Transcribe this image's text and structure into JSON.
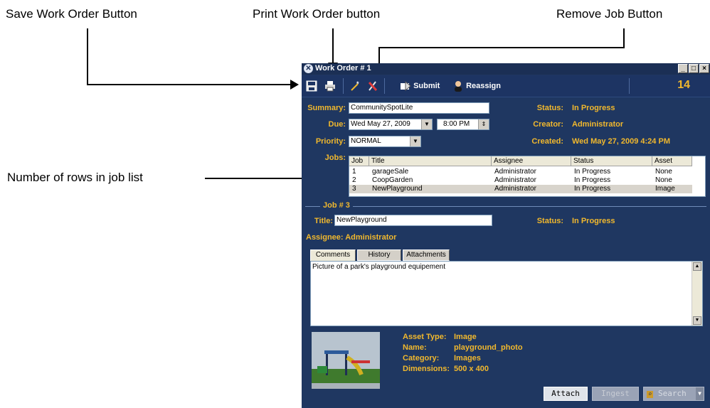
{
  "callouts": {
    "save": "Save Work Order Button",
    "print": "Print Work Order button",
    "remove": "Remove Job Button",
    "rows": "Number of rows in job list"
  },
  "window": {
    "title": "Work Order # 1",
    "buttons": {
      "min": "_",
      "max": "□",
      "close": "×"
    }
  },
  "toolbar": {
    "submit": "Submit",
    "reassign": "Reassign",
    "row_count": "14"
  },
  "order": {
    "summary_label": "Summary:",
    "summary": "CommunitySpotLite",
    "due_label": "Due:",
    "due_date": "Wed May 27, 2009",
    "due_time": "8:00 PM",
    "priority_label": "Priority:",
    "priority": "NORMAL",
    "status_label": "Status:",
    "status": "In Progress",
    "creator_label": "Creator:",
    "creator": "Administrator",
    "created_label": "Created:",
    "created": "Wed May 27, 2009 4:24 PM",
    "jobs_label": "Jobs:"
  },
  "jobs": {
    "columns": [
      "Job",
      "Title",
      "Assignee",
      "Status",
      "Asset"
    ],
    "rows": [
      {
        "job": "1",
        "title": "garageSale",
        "assignee": "Administrator",
        "status": "In Progress",
        "asset": "None"
      },
      {
        "job": "2",
        "title": "CoopGarden",
        "assignee": "Administrator",
        "status": "In Progress",
        "asset": "None"
      },
      {
        "job": "3",
        "title": "NewPlayground",
        "assignee": "Administrator",
        "status": "In Progress",
        "asset": "Image"
      }
    ]
  },
  "job_detail": {
    "heading": "Job # 3",
    "title_label": "Title:",
    "title": "NewPlayground",
    "status_label": "Status:",
    "status": "In Progress",
    "assignee_label": "Assignee:",
    "assignee": "Administrator",
    "tabs": [
      "Comments",
      "History",
      "Attachments"
    ],
    "comment": "Picture of a park's playground equipement"
  },
  "asset": {
    "type_label": "Asset Type:",
    "type": "Image",
    "name_label": "Name:",
    "name": "playground_photo",
    "category_label": "Category:",
    "category": "Images",
    "dimensions_label": "Dimensions:",
    "dimensions": "500 x 400"
  },
  "buttons": {
    "attach": "Attach",
    "ingest": "Ingest",
    "search": "Search"
  },
  "colors": {
    "window_bg": "#1f3761",
    "label": "#f1b82d"
  }
}
